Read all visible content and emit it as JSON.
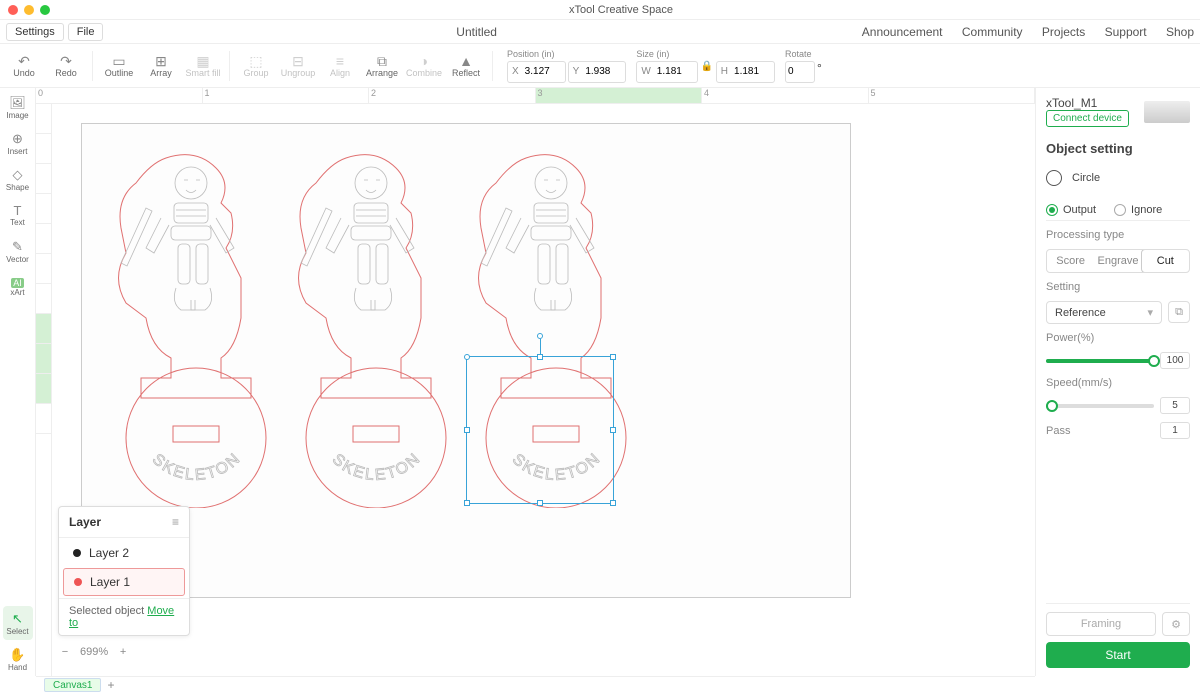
{
  "window": {
    "title": "xTool Creative Space"
  },
  "menu": {
    "settings": "Settings",
    "file": "File",
    "doc_title": "Untitled",
    "right": {
      "announcement": "Announcement",
      "community": "Community",
      "projects": "Projects",
      "support": "Support",
      "shop": "Shop"
    }
  },
  "toolbar": {
    "undo": "Undo",
    "redo": "Redo",
    "outline": "Outline",
    "array": "Array",
    "smartfill": "Smart fill",
    "group": "Group",
    "ungroup": "Ungroup",
    "align": "Align",
    "arrange": "Arrange",
    "combine": "Combine",
    "reflect": "Reflect",
    "position_label": "Position (in)",
    "x": "3.127",
    "y": "1.938",
    "size_label": "Size (in)",
    "w": "1.181",
    "h": "1.181",
    "rotate_label": "Rotate",
    "rotate": "0",
    "deg": "°"
  },
  "lefttools": {
    "image": "Image",
    "insert": "Insert",
    "shape": "Shape",
    "text": "Text",
    "vector": "Vector",
    "xart": "xArt",
    "select": "Select",
    "hand": "Hand"
  },
  "ruler": {
    "ticks": [
      "0",
      "1",
      "2",
      "3",
      "4",
      "5"
    ]
  },
  "designs": {
    "base_label": "SKELETON"
  },
  "layers": {
    "panel_title": "Layer",
    "items": [
      {
        "name": "Layer 2",
        "color": "#222",
        "selected": false
      },
      {
        "name": "Layer 1",
        "color": "#e55",
        "selected": true
      }
    ],
    "selected_label": "Selected object ",
    "moveto": "Move to"
  },
  "zoom": {
    "value": "699%"
  },
  "device": {
    "name": "xTool_M1",
    "connect": "Connect device"
  },
  "right": {
    "object_setting": "Object setting",
    "shape_name": "Circle",
    "output": "Output",
    "ignore": "Ignore",
    "processing_type": "Processing type",
    "score": "Score",
    "engrave": "Engrave",
    "cut": "Cut",
    "setting": "Setting",
    "reference": "Reference",
    "power_label": "Power(%)",
    "power": "100",
    "speed_label": "Speed(mm/s)",
    "speed": "5",
    "pass_label": "Pass",
    "pass": "1",
    "framing": "Framing",
    "start": "Start"
  },
  "bottom": {
    "canvas_tab": "Canvas1"
  }
}
